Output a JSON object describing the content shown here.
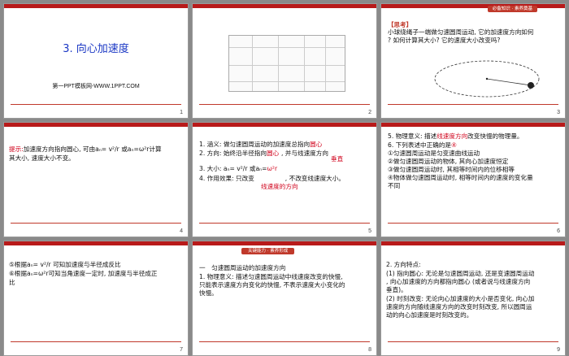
{
  "slides": [
    {
      "num": "1",
      "title": "3. 向心加速度",
      "subtitle": "第一PPT模板网-WWW.1PPT.COM"
    },
    {
      "num": "2"
    },
    {
      "num": "3",
      "tag": "必备知识 · 素养奠基",
      "heading": "【思考】",
      "lines": [
        "小球绕绳子一端做匀速圆周运动, 它的加速度方向如何",
        "? 如何计算其大小? 它的速度大小改变吗?"
      ]
    },
    {
      "num": "4",
      "lead": "提示:",
      "lines": [
        "加速度方向指向圆心, 可由aₙ= v²/r 或aₙ=ω²r计算",
        "其大小, 速度大小不变。"
      ]
    },
    {
      "num": "5",
      "lines": [
        "1. 涵义: 做匀速圆周运动的加速度总指向",
        "2. 方向: 始终沿半径指向",
        ", 并与线速度方向",
        "3. 大小: aₙ= v²/r 或aₙ=",
        "4. 作用效果: 只改变",
        ", 不改变线速度大小。"
      ],
      "fills": [
        "圆心",
        "圆心",
        "垂直",
        "ω²r",
        "线速度的方向"
      ]
    },
    {
      "num": "6",
      "lines": [
        "5. 物理意义: 描述",
        "改变快慢的物理量。",
        "6. 下列表述中正确的是",
        "①匀速圆周运动是匀变速曲线运动",
        "②做匀速圆周运动的物体, 其向心加速度恒定",
        "③做匀速圆周运动时, 其相等时间内的位移相等",
        "④物体做匀速圆周运动时, 相等时间内的速度的变化量",
        "不同"
      ],
      "fills": [
        "线速度方向",
        "④"
      ]
    },
    {
      "num": "7",
      "lines": [
        "⑤根据aₙ= v²/r 可知加速度与半径成反比",
        "⑥根据aₙ=ω²r可知当角速度一定时, 加速度与半径成正",
        "比"
      ]
    },
    {
      "num": "8",
      "tag": "关键能力 · 素养形成",
      "heading": "一　匀速圆周运动的加速度方向",
      "lines": [
        "1. 物理意义: 描述匀速圆周运动中线速度改变的快慢,",
        "只能表示速度方向变化的快慢, 不表示速度大小变化的",
        "快慢。"
      ]
    },
    {
      "num": "9",
      "lines": [
        "2. 方向特点:",
        "(1) 指向圆心: 无论是匀速圆周运动, 还是变速圆周运动",
        ", 向心加速度的方向都指向圆心 (或者说与线速度方向",
        "垂直)。",
        "(2) 时刻改变: 无论向心加速度的大小是否变化, 向心加",
        "速度的方向随线速度方向的改变时刻改变, 所以圆周运",
        "动的向心加速度是时刻改变的。"
      ]
    }
  ]
}
